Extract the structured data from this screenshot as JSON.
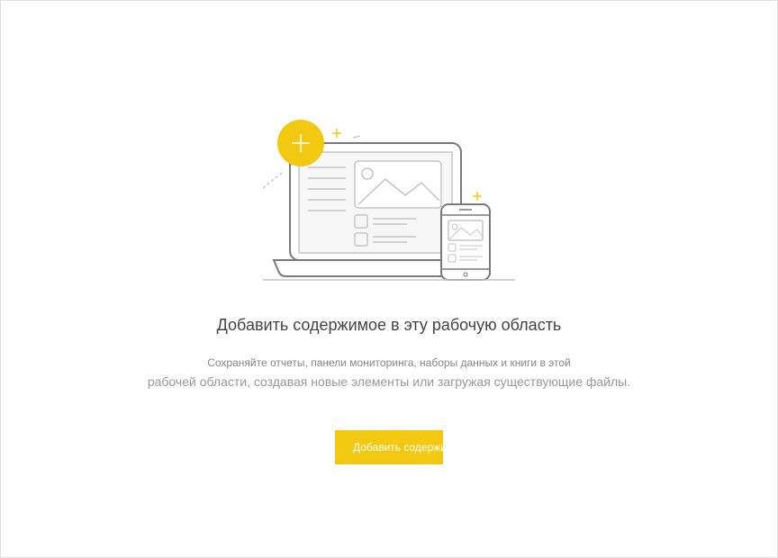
{
  "empty_state": {
    "heading": "Добавить содержимое в эту рабочую область",
    "description_line1": "Сохраняйте отчеты, панели мониторинга, наборы данных и книги в этой",
    "description_line2": "рабочей области, создавая новые элементы или загружая существующие файлы.",
    "add_button_label": "Добавить содержимое"
  },
  "icons": {
    "plus_badge": "plus-icon",
    "laptop": "laptop-icon",
    "phone": "phone-icon"
  },
  "colors": {
    "accent": "#f2c811",
    "text_primary": "#444444",
    "text_secondary": "#888888",
    "line": "#c6c6c6"
  }
}
